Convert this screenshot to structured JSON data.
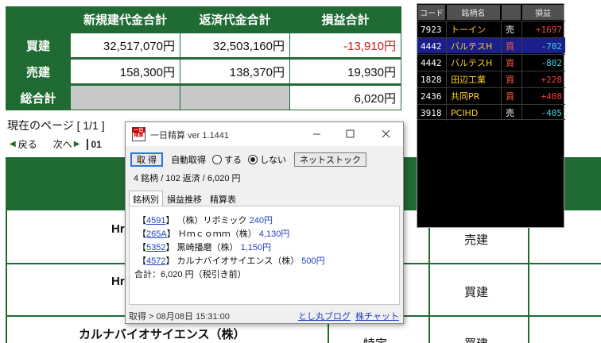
{
  "summary": {
    "headers": [
      "新規建代金合計",
      "返済代金合計",
      "損益合計"
    ],
    "rows": [
      {
        "label": "買建",
        "values": [
          "32,517,070円",
          "32,503,160円",
          "-13,910円"
        ]
      },
      {
        "label": "売建",
        "values": [
          "158,300円",
          "138,370円",
          "19,930円"
        ]
      },
      {
        "label": "総合計",
        "values": [
          "",
          "",
          "6,020円"
        ]
      }
    ]
  },
  "pager": {
    "current": "現在のページ [ 1/1 ]",
    "back": "戻る",
    "forward": "次へ",
    "page_box": "01"
  },
  "list": {
    "rows": [
      {
        "name": "Hr",
        "side": "売建"
      },
      {
        "name": "Hr",
        "side": "買建"
      },
      {
        "name": "カルナバイオサイエンス（株）",
        "side": "買建",
        "kind": "特定"
      }
    ]
  },
  "ticker": {
    "headers": [
      "コード",
      "銘柄名",
      "",
      "損益"
    ],
    "rows": [
      {
        "code": "7923",
        "name": "トーイン",
        "side": "売",
        "pnl": "+1697"
      },
      {
        "code": "4442",
        "name": "バルテスH",
        "side": "買",
        "pnl": "-702"
      },
      {
        "code": "4442",
        "name": "バルテスH",
        "side": "買",
        "pnl": "-802"
      },
      {
        "code": "1828",
        "name": "田辺工業",
        "side": "買",
        "pnl": "+228"
      },
      {
        "code": "2436",
        "name": "共同PR",
        "side": "買",
        "pnl": "+408"
      },
      {
        "code": "3918",
        "name": "PCIHD",
        "side": "売",
        "pnl": "-405"
      }
    ],
    "selected_index": 1
  },
  "window": {
    "icon_top": "一日",
    "icon_bottom": "精算",
    "title": "一日精算 ver 1.1441",
    "fetch_button": "取 得",
    "auto_label": "自動取得",
    "radio_yes": "する",
    "radio_no": "しない",
    "radio_selected": "しない",
    "netstock_button": "ネットストック",
    "stats": "4 銘柄 / 102 返済 / 6,020 円",
    "tabs": [
      "銘柄別",
      "損益推移",
      "精算表"
    ],
    "active_tab": "銘柄別",
    "entries": [
      {
        "code": "4591",
        "name": "（株）リボミック",
        "amount": "240円"
      },
      {
        "code": "265A",
        "name": "Ｈｍｃｏｍｍ（株）",
        "amount": "4,130円"
      },
      {
        "code": "5352",
        "name": "黒崎播磨（株）",
        "amount": "1,150円"
      },
      {
        "code": "4572",
        "name": "カルナバイオサイエンス（株）",
        "amount": "500円"
      }
    ],
    "total": "合計：6,020 円（税引き前）",
    "status_time": "取得 > 08月08日 15:31:00",
    "link_blog": "とし丸ブログ",
    "link_chart": "株チャット"
  },
  "colors": {
    "table_green": "#1f6b33",
    "negative_red": "#d8141a",
    "link_blue": "#1f3fbf",
    "ticker_name_yellow": "#ffd21f",
    "ticker_pos_red": "#ff3b3b",
    "ticker_neg_cyan": "#44d2e6"
  }
}
